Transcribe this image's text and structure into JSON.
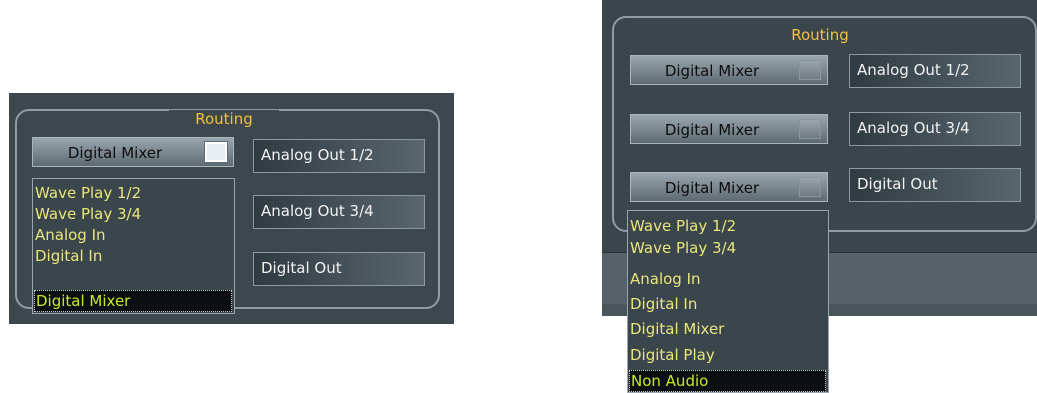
{
  "left_panel": {
    "title": "Routing",
    "source_combo": "Digital Mixer",
    "outputs": [
      "Analog Out 1/2",
      "Analog Out 3/4",
      "Digital Out"
    ],
    "dropdown": [
      "Wave Play 1/2",
      "Wave Play 3/4",
      "Analog In",
      "Digital In",
      "Digital Mixer"
    ],
    "selected": "Digital Mixer"
  },
  "right_panel": {
    "title": "Routing",
    "source_combos": [
      "Digital Mixer",
      "Digital Mixer",
      "Digital Mixer"
    ],
    "outputs": [
      "Analog Out 1/2",
      "Analog Out 3/4",
      "Digital Out"
    ],
    "dropdown": [
      "Wave Play 1/2",
      "Wave Play 3/4",
      "Analog In",
      "Digital In",
      "Digital Mixer",
      "Digital Play",
      "Non Audio"
    ],
    "selected": "Non Audio"
  },
  "colors": {
    "title": "#f3c13a",
    "list_text": "#e9e67a",
    "selected_text": "#c7ea22",
    "panel_bg": "#3c474e"
  }
}
